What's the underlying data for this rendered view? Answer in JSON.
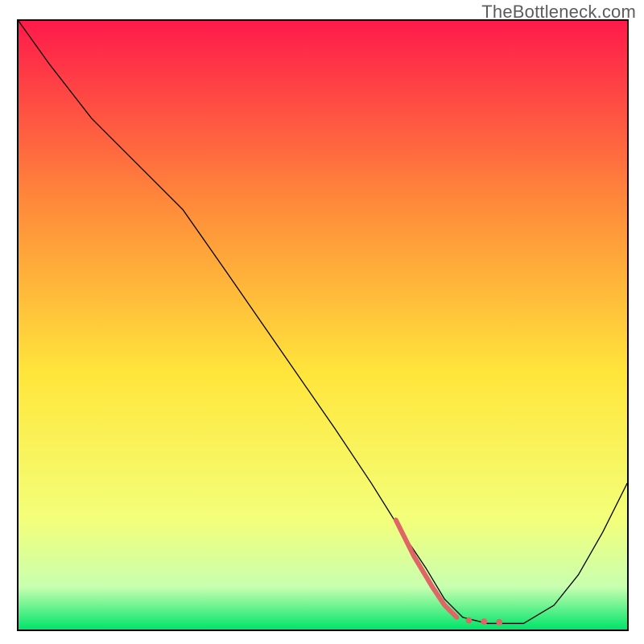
{
  "watermark": "TheBottleneck.com",
  "chart_data": {
    "type": "line",
    "title": "",
    "xlabel": "",
    "ylabel": "",
    "xlim": [
      0,
      100
    ],
    "ylim": [
      0,
      100
    ],
    "gradient_colors": {
      "top": "#ff1a4b",
      "mid_upper": "#ff8a3a",
      "mid": "#ffe63b",
      "mid_lower": "#f3ff7a",
      "low": "#c8ffb0",
      "bottom": "#00e46a"
    },
    "series": [
      {
        "name": "bottleneck-curve",
        "stroke": "#000000",
        "stroke_width": 1.3,
        "x": [
          0,
          5,
          12,
          20,
          27,
          34,
          43,
          52,
          58,
          63,
          67,
          70,
          73,
          77,
          80,
          83,
          88,
          92,
          96,
          100
        ],
        "values": [
          100,
          93,
          84,
          76,
          69,
          59,
          46,
          33,
          24,
          16,
          10,
          5,
          2,
          1,
          1,
          1,
          4,
          9,
          16,
          24
        ]
      },
      {
        "name": "bottleneck-highlight-band",
        "stroke": "#e06666",
        "stroke_width": 6,
        "x": [
          62,
          65,
          68,
          70,
          72
        ],
        "values": [
          18,
          12,
          7,
          4,
          2
        ]
      }
    ],
    "highlight_dots": {
      "stroke": "#e06666",
      "radius": 4,
      "x": [
        74,
        76.5,
        79
      ],
      "values": [
        1.5,
        1.3,
        1.2
      ]
    }
  }
}
